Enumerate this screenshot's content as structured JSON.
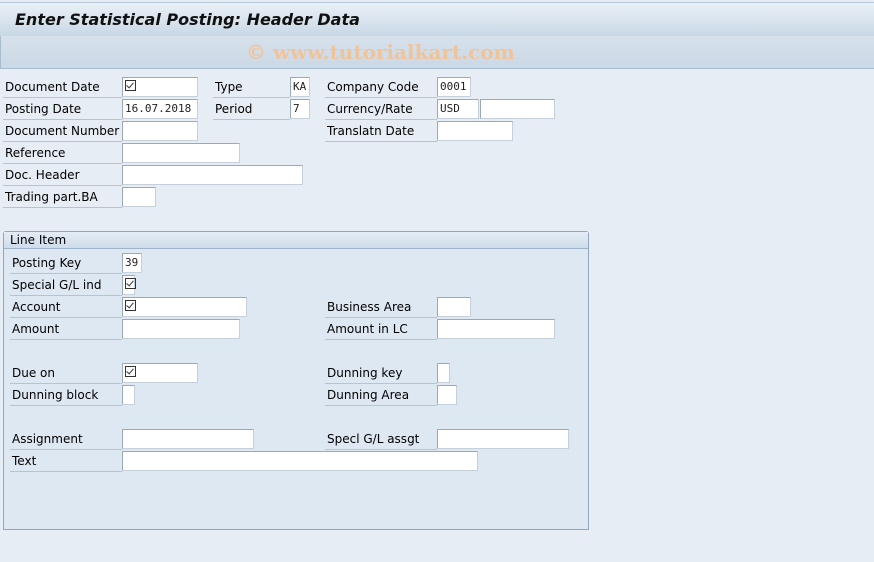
{
  "title": "Enter Statistical Posting: Header Data",
  "watermark": "© www.tutorialkart.com",
  "header_fields": [
    {
      "label": "Document Date",
      "value": "",
      "required": true
    },
    {
      "label": "Type",
      "value": "KA"
    },
    {
      "label": "Company Code",
      "value": "0001"
    },
    {
      "label": "Posting Date",
      "value": "16.07.2018"
    },
    {
      "label": "Period",
      "value": "7"
    },
    {
      "label": "Currency/Rate",
      "value": "USD",
      "value2": ""
    },
    {
      "label": "Document Number",
      "value": ""
    },
    {
      "label": "Translatn Date",
      "value": ""
    },
    {
      "label": "Reference",
      "value": ""
    },
    {
      "label": "Doc. Header",
      "value": ""
    },
    {
      "label": "Trading part.BA",
      "value": ""
    }
  ],
  "line_item": {
    "title": "Line Item",
    "fields": [
      {
        "label": "Posting Key",
        "value": "39"
      },
      {
        "label": "Special G/L ind",
        "value": "",
        "required": true
      },
      {
        "label": "Account",
        "value": "",
        "required": true
      },
      {
        "label": "Business Area",
        "value": ""
      },
      {
        "label": "Amount",
        "value": ""
      },
      {
        "label": "Amount in LC",
        "value": ""
      },
      {
        "label": "Due on",
        "value": "",
        "required": true
      },
      {
        "label": "Dunning key",
        "value": ""
      },
      {
        "label": "Dunning block",
        "value": ""
      },
      {
        "label": "Dunning Area",
        "value": ""
      },
      {
        "label": "Assignment",
        "value": ""
      },
      {
        "label": "Specl G/L assgt",
        "value": ""
      },
      {
        "label": "Text",
        "value": ""
      }
    ]
  }
}
